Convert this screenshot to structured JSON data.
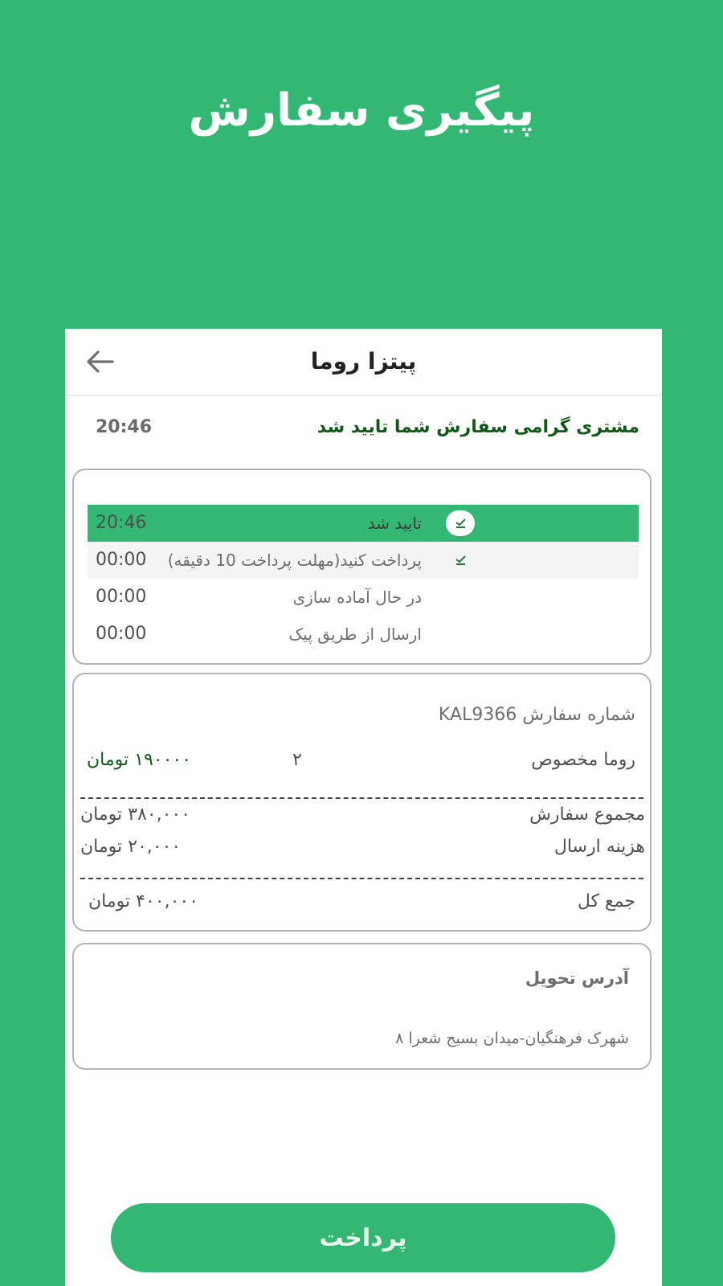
{
  "page": {
    "title": "پیگیری سفارش"
  },
  "header": {
    "restaurant_name": "پیتزا روما",
    "back_icon": "arrow-left-icon"
  },
  "notice": {
    "message": "مشتری گرامی سفارش شما تایید شد",
    "time": "20:46"
  },
  "status_steps": [
    {
      "time": "20:46",
      "label": "تایید شد",
      "state": "active",
      "icon": "check-icon"
    },
    {
      "time": "00:00",
      "label": "پرداخت کنید(مهلت پرداخت 10 دقیقه)",
      "state": "pending",
      "icon": "check-icon"
    },
    {
      "time": "00:00",
      "label": "در حال آماده سازی",
      "state": "inactive"
    },
    {
      "time": "00:00",
      "label": "ارسال از طریق پیک",
      "state": "inactive"
    }
  ],
  "invoice": {
    "order_number": "شماره سفارش KAL9366",
    "items": [
      {
        "name": "روما مخصوص",
        "qty": "۲",
        "price": "۱۹۰۰۰۰ تومان"
      }
    ],
    "order_total_label": "مجموع سفارش",
    "order_total_value": "۳۸۰,۰۰۰ تومان",
    "delivery_label": "هزینه ارسال",
    "delivery_value": "۲۰,۰۰۰ تومان",
    "grand_total_label": "جمع کل",
    "grand_total_value": "۴۰۰,۰۰۰ تومان"
  },
  "address": {
    "title": "آدرس تحویل",
    "text": "شهرک فرهنگیان-میدان بسیج شعرا ۸"
  },
  "pay_button": {
    "label": "پرداخت"
  },
  "colors": {
    "brand": "#33b874",
    "dark_green": "#0f5b16"
  }
}
